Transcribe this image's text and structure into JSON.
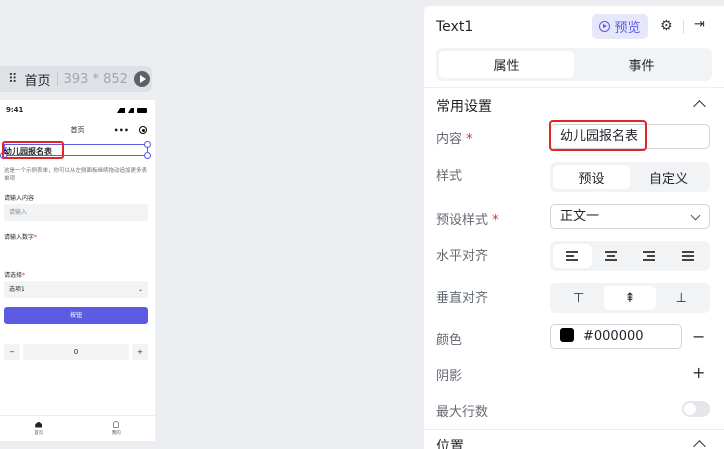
{
  "canvas": {
    "page_name": "首页",
    "page_size": "393 * 852",
    "phone": {
      "time": "9:41",
      "nav_title": "首页",
      "more": "•••",
      "title": "幼儿园报名表",
      "description": "这是一个示例表单，你可以从左侧面板继续拖动追加更多表单项",
      "field1_label": "请输入内容",
      "field1_placeholder": "请输入",
      "field2_label": "请输入数字",
      "field2_minus": "−",
      "field2_value": "0",
      "field2_plus": "+",
      "field3_label": "请选择",
      "field3_value": "选项1",
      "button": "按钮",
      "tab_home": "首页",
      "tab_me": "我的"
    }
  },
  "panel": {
    "component_name": "Text1",
    "preview_label": "预览",
    "tabs": [
      "属性",
      "事件"
    ],
    "section_common": "常用设置",
    "content_label": "内容",
    "content_value": "幼儿园报名表",
    "style_label": "样式",
    "style_options": [
      "预设",
      "自定义"
    ],
    "preset_style_label": "预设样式",
    "preset_style_value": "正文一",
    "h_align_label": "水平对齐",
    "v_align_label": "垂直对齐",
    "v_align_icons": [
      "⊤",
      "⇞",
      "⊥"
    ],
    "color_label": "颜色",
    "color_value": "#000000",
    "color_swatch": "#000000",
    "minus": "−",
    "shadow_label": "阴影",
    "plus": "+",
    "max_lines_label": "最大行数",
    "section_position": "位置",
    "required_mark": "*",
    "accent": "#5b5ce2",
    "highlight": "#e0252b"
  }
}
